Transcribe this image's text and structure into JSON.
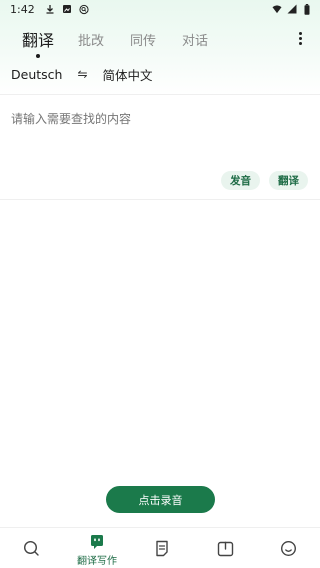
{
  "status_bar": {
    "time": "1:42",
    "left_icons": [
      "download-icon",
      "photo-icon",
      "search-circle-icon"
    ],
    "right_icons": [
      "wifi-icon",
      "signal-icon",
      "battery-icon"
    ]
  },
  "tabs": [
    {
      "label": "翻译",
      "active": true
    },
    {
      "label": "批改",
      "active": false
    },
    {
      "label": "同传",
      "active": false
    },
    {
      "label": "对话",
      "active": false
    }
  ],
  "languages": {
    "source": "Deutsch",
    "swap_symbol": "⇋",
    "target": "简体中文"
  },
  "input": {
    "placeholder": "请输入需要查找的内容",
    "value": ""
  },
  "actions": {
    "pronounce_label": "发音",
    "translate_label": "翻译"
  },
  "record_button": {
    "label": "点击录音"
  },
  "bottom_nav": {
    "items": [
      {
        "icon": "search-icon",
        "label": ""
      },
      {
        "icon": "write-icon",
        "label": "翻译写作",
        "active": true
      },
      {
        "icon": "document-icon",
        "label": ""
      },
      {
        "icon": "book-icon",
        "label": ""
      },
      {
        "icon": "smile-icon",
        "label": ""
      }
    ]
  },
  "colors": {
    "accent": "#1b7a4b",
    "pill_bg": "#e9f4ee",
    "pill_text": "#1d6b45",
    "header_gradient_top": "#e9f8ef"
  }
}
